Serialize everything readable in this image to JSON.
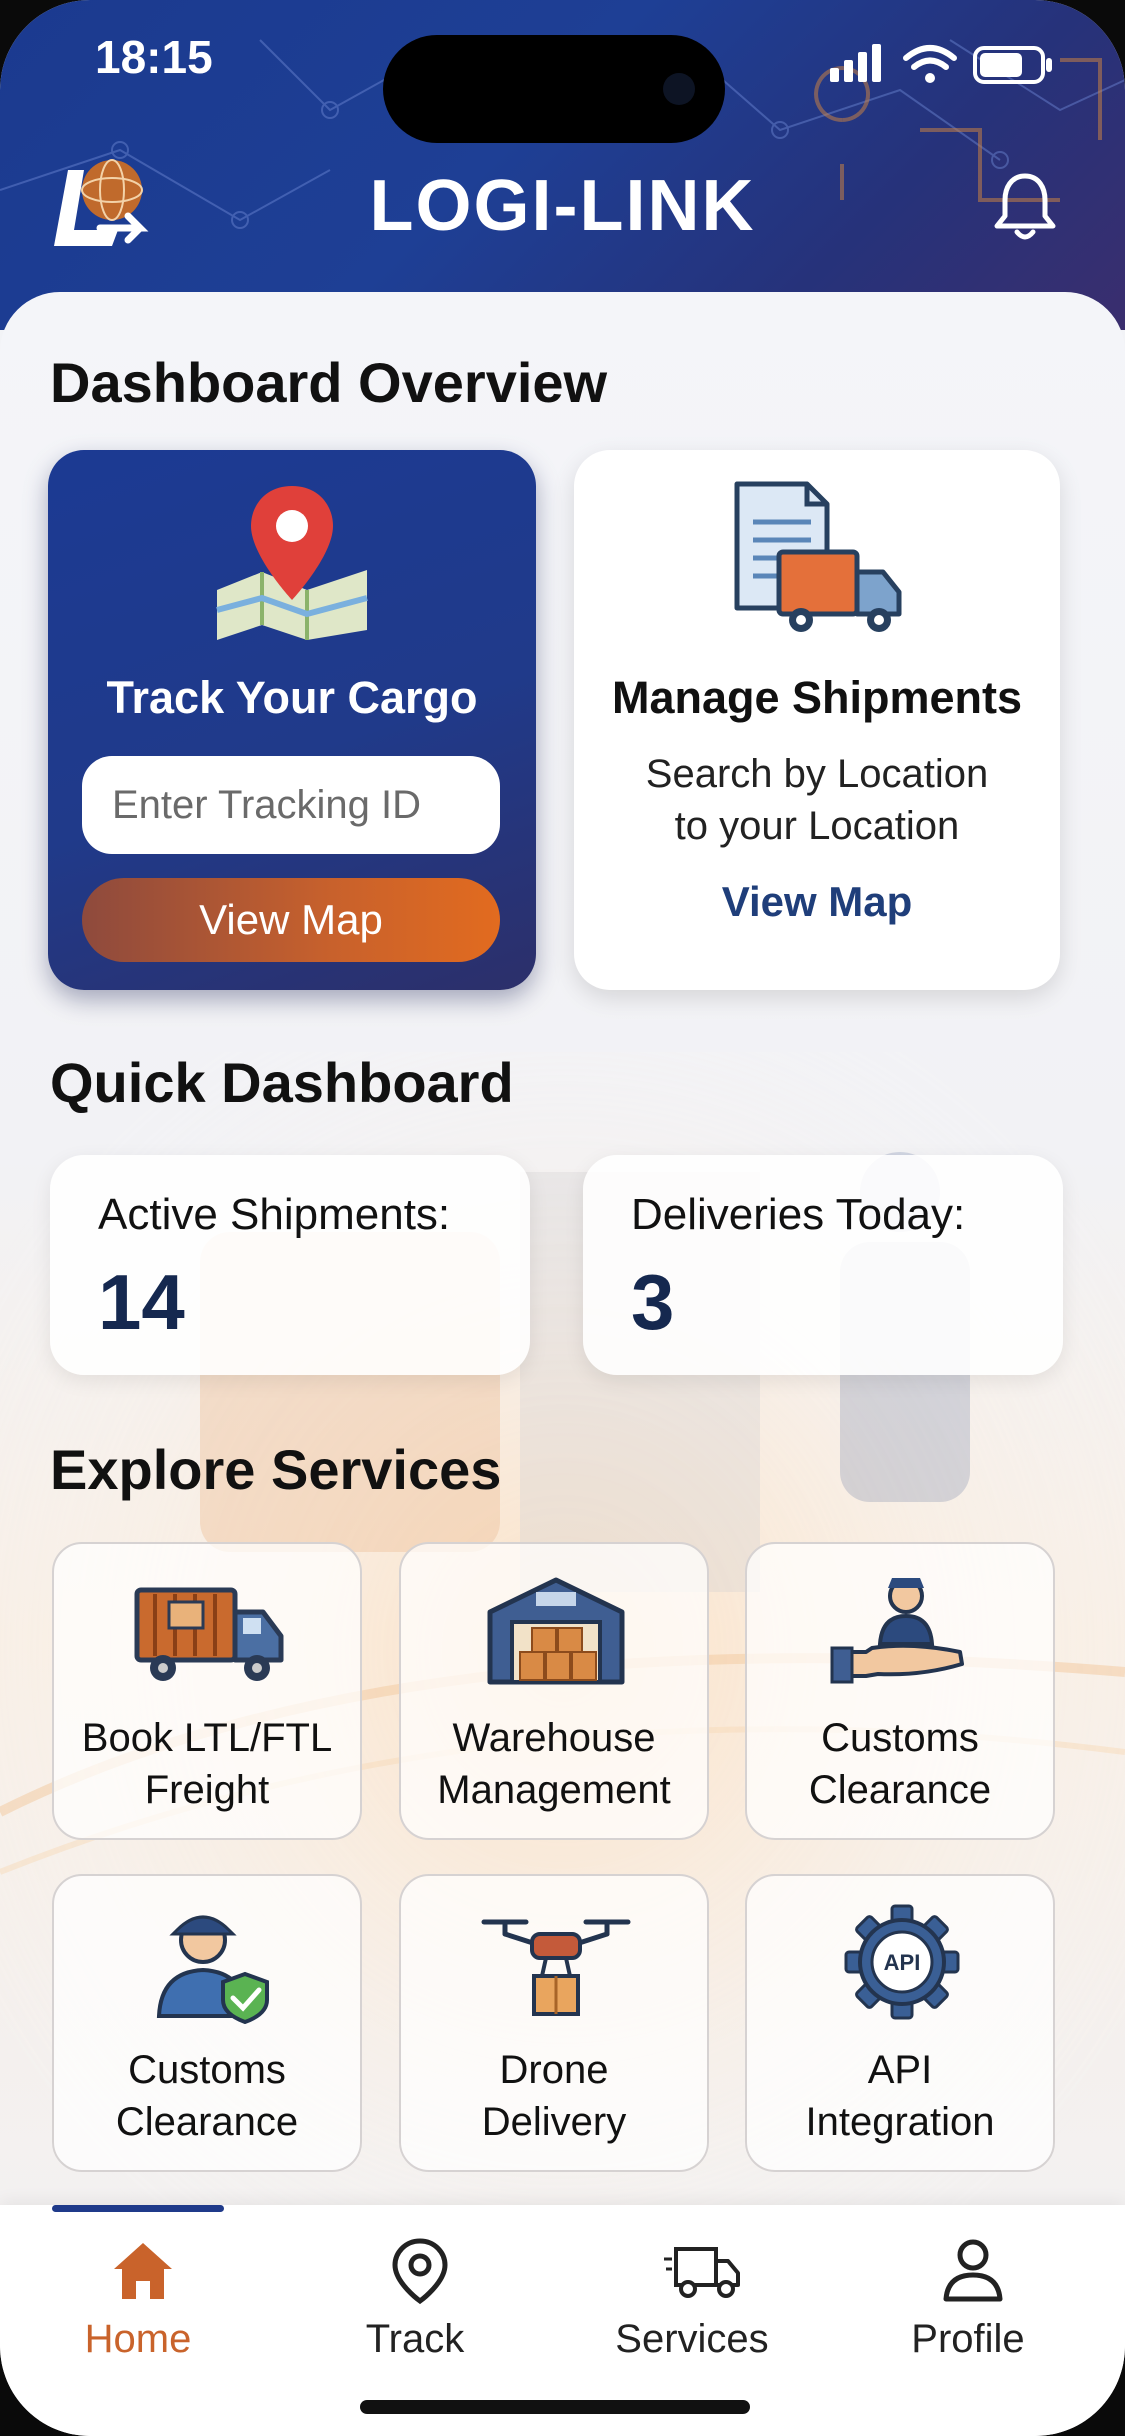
{
  "status_bar": {
    "time": "18:15"
  },
  "header": {
    "title": "LOGI-LINK"
  },
  "dashboard": {
    "title": "Dashboard Overview",
    "track_card": {
      "title": "Track Your Cargo",
      "input_placeholder": "Enter Tracking ID",
      "button_label": "View Map"
    },
    "ship_card": {
      "title": "Manage Shipments",
      "subtitle_line1": "Search by Location",
      "subtitle_line2": "to your Location",
      "link_label": "View Map"
    }
  },
  "quick": {
    "title": "Quick Dashboard",
    "stats": [
      {
        "label": "Active Shipments:",
        "value": "14"
      },
      {
        "label": "Deliveries Today:",
        "value": "3"
      }
    ]
  },
  "services": {
    "title": "Explore Services",
    "tiles": [
      {
        "line1": "Book LTL/FTL",
        "line2": "Freight",
        "icon": "truck-icon"
      },
      {
        "line1": "Warehouse",
        "line2": "Management",
        "icon": "warehouse-icon"
      },
      {
        "line1": "Customs",
        "line2": "Clearance",
        "icon": "hand-person-icon"
      },
      {
        "line1": "Customs",
        "line2": "Clearance",
        "icon": "officer-shield-icon"
      },
      {
        "line1": "Drone",
        "line2": "Delivery",
        "icon": "drone-icon"
      },
      {
        "line1": "API",
        "line2": "Integration",
        "icon": "api-gear-icon"
      }
    ]
  },
  "nav": {
    "items": [
      {
        "label": "Home",
        "icon": "home-icon",
        "active": true
      },
      {
        "label": "Track",
        "icon": "location-pin-icon",
        "active": false
      },
      {
        "label": "Services",
        "icon": "truck-icon",
        "active": false
      },
      {
        "label": "Profile",
        "icon": "person-icon",
        "active": false
      }
    ]
  },
  "colors": {
    "header": "#1e3f95",
    "accent_orange": "#d9661f",
    "text_dark_blue": "#15284f",
    "nav_active": "#c9632b"
  }
}
